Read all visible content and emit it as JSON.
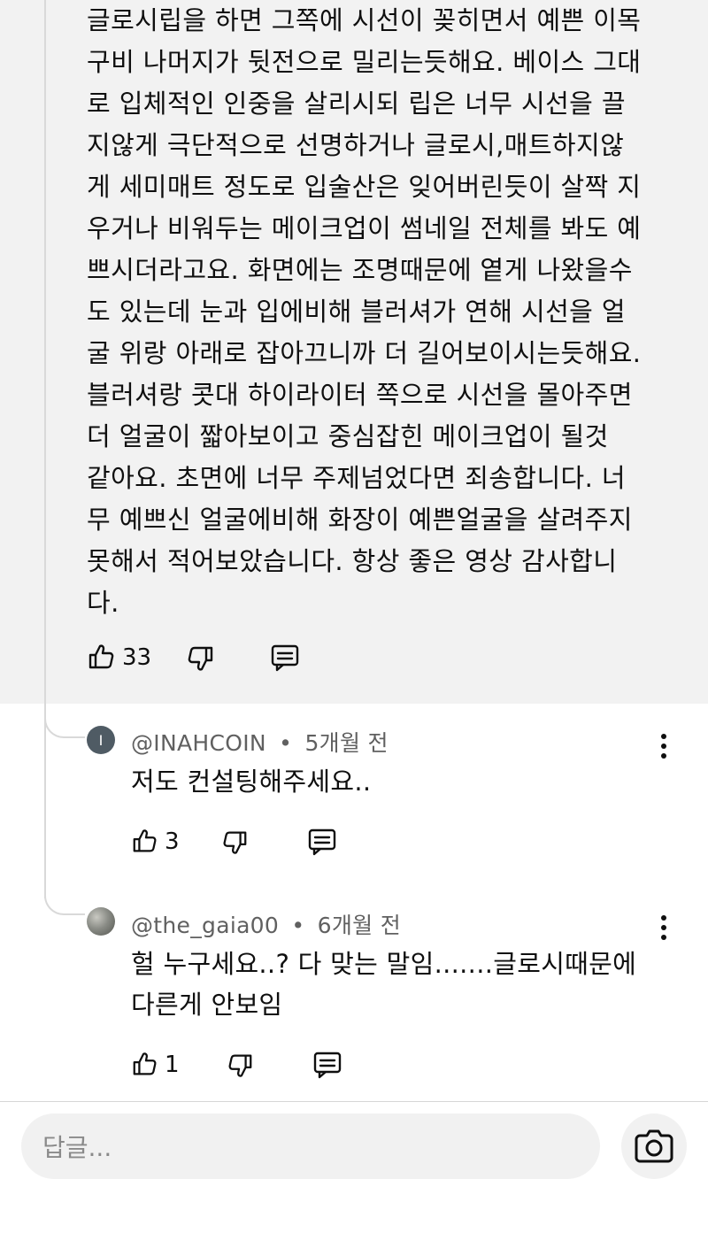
{
  "main_comment": {
    "text": "글로시립을 하면 그쪽에 시선이 꽂히면서 예쁜 이목\n구비 나머지가 뒷전으로 밀리는듯해요. 베이스 그대\n로 입체적인 인중을 살리시되 립은 너무 시선을 끌\n지않게 극단적으로 선명하거나 글로시,매트하지않\n게 세미매트 정도로 입술산은 잊어버린듯이 살짝 지\n우거나 비워두는 메이크업이 썸네일 전체를 봐도 예\n쁘시더라고요. 화면에는 조명때문에 옅게 나왔을수\n도 있는데 눈과 입에비해 블러셔가 연해 시선을 얼\n굴 위랑 아래로 잡아끄니까 더 길어보이시는듯해요.\n블러셔랑 콧대 하이라이터 쪽으로 시선을 몰아주면\n더 얼굴이  짧아보이고 중심잡힌 메이크업이 될것\n같아요. 초면에 너무 주제넘었다면 죄송합니다. 너\n무 예쁘신 얼굴에비해 화장이 예쁜얼굴을 살려주지\n못해서 적어보았습니다. 항상 좋은 영상 감사합니\n다.",
    "like_count": "33"
  },
  "replies": [
    {
      "avatar_letter": "I",
      "author": "@INAHCOIN",
      "separator": "•",
      "time": "5개월 전",
      "text": "저도 컨설팅해주세요..",
      "like_count": "3"
    },
    {
      "avatar_letter": "",
      "author": "@the_gaia00",
      "separator": "•",
      "time": "6개월 전",
      "text": "헐 누구세요..? 다 맞는 말임.......글로시때문에\n다른게 안보임",
      "like_count": "1"
    }
  ],
  "reply_box": {
    "placeholder": "답글..."
  },
  "icons": {
    "like": "thumbs-up-icon",
    "dislike": "thumbs-down-icon",
    "reply": "comment-icon",
    "more": "more-vertical-icon",
    "camera": "camera-icon"
  },
  "colors": {
    "main_bg": "#f2f2f2",
    "text": "#0f0f0f",
    "meta": "#606060",
    "input_bg": "#f1f1f1"
  }
}
